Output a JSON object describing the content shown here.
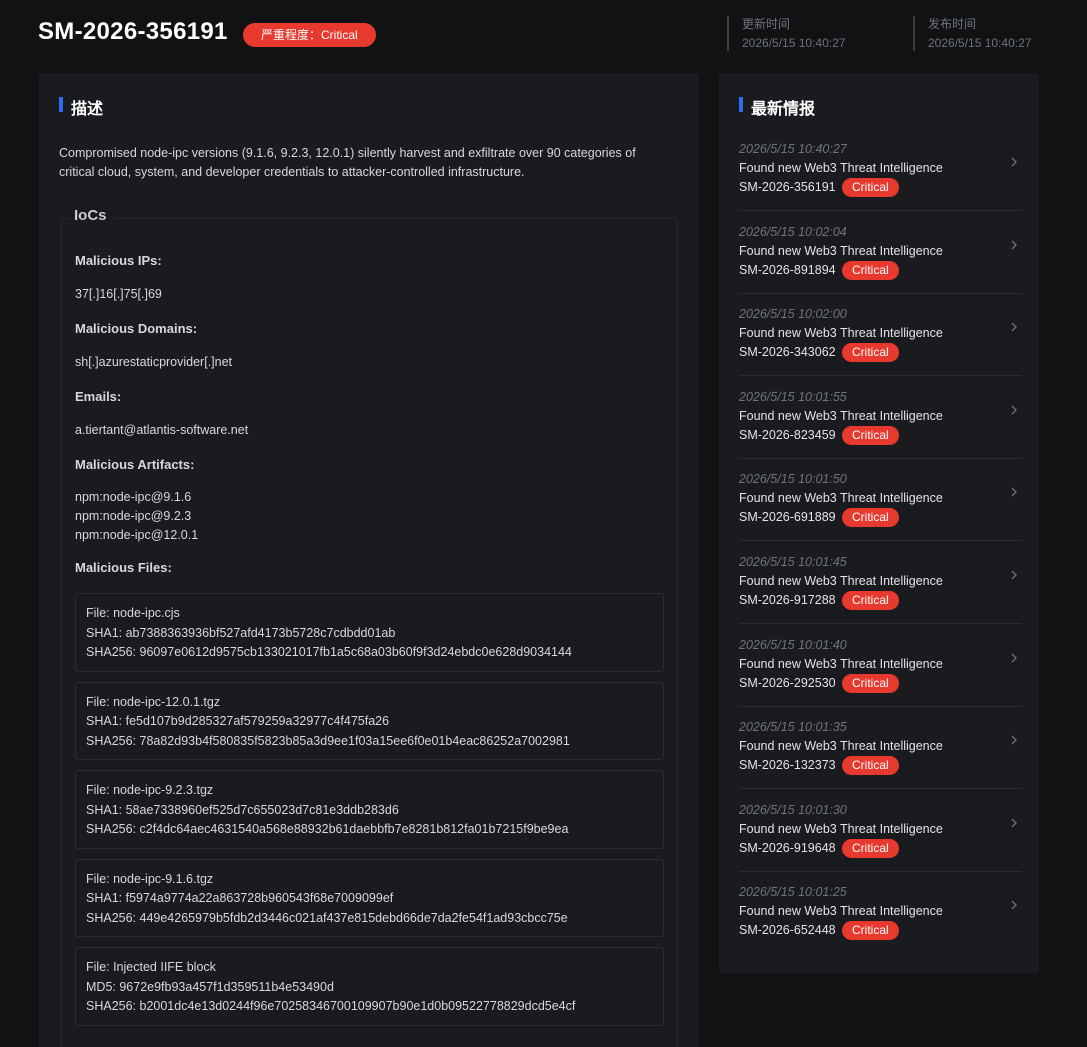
{
  "header": {
    "title": "SM-2026-356191",
    "severity_label": "严重程度：",
    "severity_value": "Critical",
    "updated_label": "更新时间",
    "updated_value": "2026/5/15 10:40:27",
    "published_label": "发布时间",
    "published_value": "2026/5/15 10:40:27"
  },
  "colors": {
    "accent": "#2f6bf3",
    "critical": "#e8392f",
    "background": "#111214",
    "panel": "#1a1b1e"
  },
  "description": {
    "title": "描述",
    "text": "Compromised node-ipc versions (9.1.6, 9.2.3, 12.0.1) silently harvest and exfiltrate over 90 categories of critical cloud, system, and developer credentials to attacker-controlled infrastructure."
  },
  "iocs": {
    "title": "IoCs",
    "malicious_ips_label": "Malicious IPs:",
    "malicious_ips": "37[.]16[.]75[.]69",
    "malicious_domains_label": "Malicious Domains:",
    "malicious_domains": "sh[.]azurestaticprovider[.]net",
    "emails_label": "Emails:",
    "emails": "a.tiertant@atlantis-software.net",
    "artifacts_label": "Malicious Artifacts:",
    "artifacts": [
      "npm:node-ipc@9.1.6",
      "npm:node-ipc@9.2.3",
      "npm:node-ipc@12.0.1"
    ],
    "files_label": "Malicious Files:",
    "files": [
      {
        "line1": "File: node-ipc.cjs",
        "line2": "SHA1: ab7388363936bf527afd4173b5728c7cdbdd01ab",
        "line3": "SHA256: 96097e0612d9575cb133021017fb1a5c68a03b60f9f3d24ebdc0e628d9034144"
      },
      {
        "line1": "File: node-ipc-12.0.1.tgz",
        "line2": "SHA1: fe5d107b9d285327af579259a32977c4f475fa26",
        "line3": "SHA256: 78a82d93b4f580835f5823b85a3d9ee1f03a15ee6f0e01b4eac86252a7002981"
      },
      {
        "line1": "File: node-ipc-9.2.3.tgz",
        "line2": "SHA1: 58ae7338960ef525d7c655023d7c81e3ddb283d6",
        "line3": "SHA256: c2f4dc64aec4631540a568e88932b61daebbfb7e8281b812fa01b7215f9be9ea"
      },
      {
        "line1": "File: node-ipc-9.1.6.tgz",
        "line2": "SHA1: f5974a9774a22a863728b960543f68e7009099ef",
        "line3": "SHA256: 449e4265979b5fdb2d3446c021af437e815debd66de7da2fe54f1ad93cbcc75e"
      },
      {
        "line1": "File: Injected IIFE block",
        "line2": "MD5: 9672e9fb93a457f1d359511b4e53490d",
        "line3": "SHA256: b2001dc4e13d0244f96e70258346700109907b90e1d0b09522778829dcd5e4cf"
      }
    ]
  },
  "latest": {
    "title": "最新情报",
    "items": [
      {
        "time": "2026/5/15 10:40:27",
        "text": "Found new Web3 Threat Intelligence",
        "id": "SM-2026-356191",
        "badge": "Critical"
      },
      {
        "time": "2026/5/15 10:02:04",
        "text": "Found new Web3 Threat Intelligence",
        "id": "SM-2026-891894",
        "badge": "Critical"
      },
      {
        "time": "2026/5/15 10:02:00",
        "text": "Found new Web3 Threat Intelligence",
        "id": "SM-2026-343062",
        "badge": "Critical"
      },
      {
        "time": "2026/5/15 10:01:55",
        "text": "Found new Web3 Threat Intelligence",
        "id": "SM-2026-823459",
        "badge": "Critical"
      },
      {
        "time": "2026/5/15 10:01:50",
        "text": "Found new Web3 Threat Intelligence",
        "id": "SM-2026-691889",
        "badge": "Critical"
      },
      {
        "time": "2026/5/15 10:01:45",
        "text": "Found new Web3 Threat Intelligence",
        "id": "SM-2026-917288",
        "badge": "Critical"
      },
      {
        "time": "2026/5/15 10:01:40",
        "text": "Found new Web3 Threat Intelligence",
        "id": "SM-2026-292530",
        "badge": "Critical"
      },
      {
        "time": "2026/5/15 10:01:35",
        "text": "Found new Web3 Threat Intelligence",
        "id": "SM-2026-132373",
        "badge": "Critical"
      },
      {
        "time": "2026/5/15 10:01:30",
        "text": "Found new Web3 Threat Intelligence",
        "id": "SM-2026-919648",
        "badge": "Critical"
      },
      {
        "time": "2026/5/15 10:01:25",
        "text": "Found new Web3 Threat Intelligence",
        "id": "SM-2026-652448",
        "badge": "Critical"
      }
    ]
  }
}
